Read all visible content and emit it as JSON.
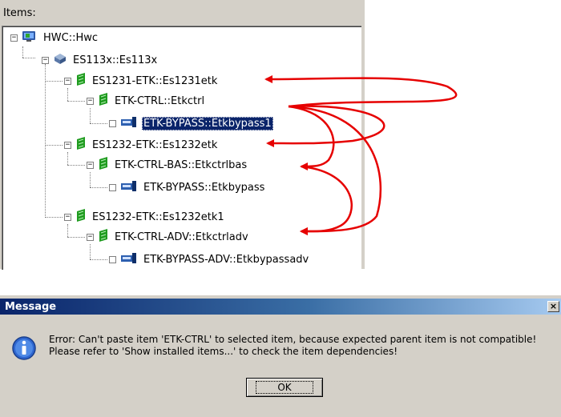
{
  "items_panel": {
    "label": "Items:",
    "tree": [
      {
        "label": "HWC::Hwc",
        "expander": "−",
        "icon": "hwc-icon",
        "selected": false
      },
      {
        "label": "ES113x::Es113x",
        "expander": "−",
        "icon": "module-icon",
        "selected": false
      },
      {
        "label": "ES1231-ETK::Es1231etk",
        "expander": "−",
        "icon": "board-icon",
        "selected": false
      },
      {
        "label": "ETK-CTRL::Etkctrl",
        "expander": "−",
        "icon": "board-icon",
        "selected": false
      },
      {
        "label": "ETK-BYPASS::Etkbypass1",
        "expander": "",
        "icon": "bypass-icon",
        "selected": true
      },
      {
        "label": "ES1232-ETK::Es1232etk",
        "expander": "−",
        "icon": "board-icon",
        "selected": false
      },
      {
        "label": "ETK-CTRL-BAS::Etkctrlbas",
        "expander": "−",
        "icon": "board-icon",
        "selected": false
      },
      {
        "label": "ETK-BYPASS::Etkbypass",
        "expander": "",
        "icon": "bypass-icon",
        "selected": false
      },
      {
        "label": "ES1232-ETK::Es1232etk1",
        "expander": "−",
        "icon": "board-icon",
        "selected": false
      },
      {
        "label": "ETK-CTRL-ADV::Etkctrladv",
        "expander": "−",
        "icon": "board-icon",
        "selected": false
      },
      {
        "label": "ETK-BYPASS-ADV::Etkbypassadv",
        "expander": "",
        "icon": "bypass-icon",
        "selected": false
      }
    ],
    "arrow_color": "#e60000"
  },
  "message_dialog": {
    "title": "Message",
    "close_label": "×",
    "line1": "Error: Can't paste item 'ETK-CTRL' to selected item, because expected parent item is not compatible!",
    "line2": "Please refer to 'Show installed items...' to check the item dependencies!",
    "ok_label": "OK",
    "icon": "info-icon"
  }
}
